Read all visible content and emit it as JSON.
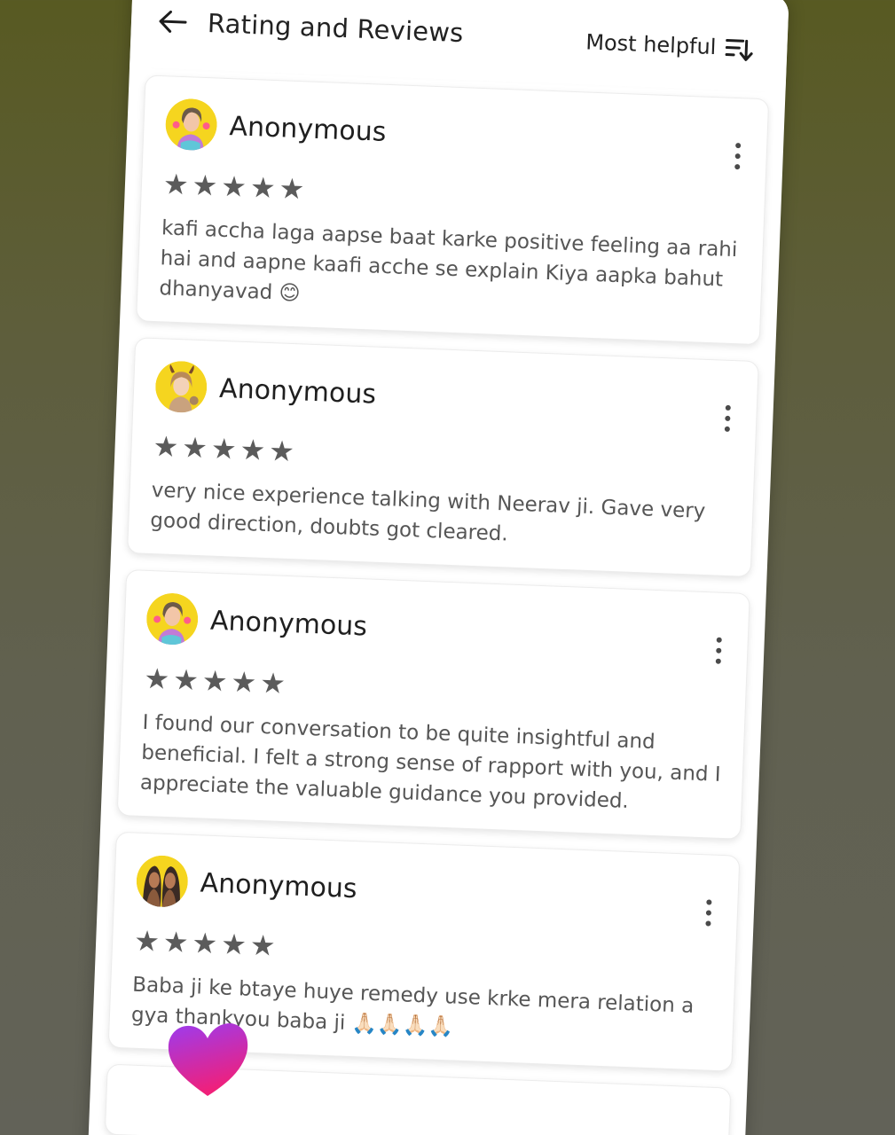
{
  "header": {
    "title": "Rating and Reviews",
    "sort_label": "Most helpful",
    "back_icon": "arrow-left-icon",
    "sort_icon": "sort-descending-icon"
  },
  "reviews": [
    {
      "name": "Anonymous",
      "rating": 5,
      "stars": "★★★★★",
      "text": "kafi accha laga aapse baat karke positive feeling aa rahi hai and aapne kaafi acche se explain Kiya aapka bahut dhanyavad 😊",
      "avatar_icon": "avatar-girl-flowers-icon"
    },
    {
      "name": "Anonymous",
      "rating": 5,
      "stars": "★★★★★",
      "text": "very nice experience talking with Neerav ji. Gave very good direction, doubts got cleared.",
      "avatar_icon": "avatar-girl-horns-icon"
    },
    {
      "name": "Anonymous",
      "rating": 5,
      "stars": "★★★★★",
      "text": "I found our conversation to be quite insightful and beneficial. I felt a strong sense of rapport with you, and I appreciate the valuable guidance you provided.",
      "avatar_icon": "avatar-girl-flowers-icon"
    },
    {
      "name": "Anonymous",
      "rating": 5,
      "stars": "★★★★★",
      "text": "Baba ji ke btaye huye remedy use krke mera relation a gya thankyou baba ji 🙏🏻🙏🏻🙏🏻🙏🏻",
      "avatar_icon": "avatar-two-girls-icon"
    }
  ],
  "colors": {
    "avatar_bg": "#f5d51f",
    "star": "#5b5b5b",
    "heart_top": "#9b3cf0",
    "heart_bottom": "#f0207a"
  }
}
